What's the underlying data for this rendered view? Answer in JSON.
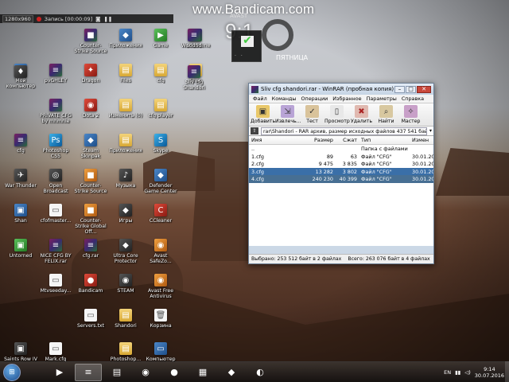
{
  "watermark": "www.Bandicam.com",
  "recorder": {
    "resolution": "1280x960",
    "status": "Запись [00:00:09]"
  },
  "gadget": {
    "brand": "AVAST",
    "time": "9:1",
    "day": "ПЯТНИЦА",
    "extra": "· ·"
  },
  "desktop_icons": [
    {
      "label": "1280x960",
      "glyph": "▣",
      "kind": "g-dark"
    },
    {
      "label": "Запись",
      "glyph": "●",
      "kind": "g-red"
    },
    {
      "label": "",
      "glyph": "≡",
      "kind": "g-rar"
    },
    {
      "label": "",
      "glyph": "▤",
      "kind": "g-folder"
    },
    {
      "label": "Сборник",
      "glyph": "▦",
      "kind": "g-folder"
    },
    {
      "label": "Лаунчер",
      "glyph": "■",
      "kind": "g-rar"
    },
    {
      "label": "Counter-Strike Source",
      "glyph": "■",
      "kind": "g-rar"
    },
    {
      "label": "Приложения",
      "glyph": "◆",
      "kind": "g-app"
    },
    {
      "label": "Game",
      "glyph": "▶",
      "kind": "g-green"
    },
    {
      "label": "WorldScene",
      "glyph": "≡",
      "kind": "g-rar"
    },
    {
      "label": "sound",
      "glyph": "≡",
      "kind": "g-rar"
    },
    {
      "label": "Мой компьютер",
      "glyph": "▭",
      "kind": "g-app"
    },
    {
      "label": "",
      "glyph": "♦",
      "kind": "g-dark"
    },
    {
      "label": "pvGHLEY",
      "glyph": "≡",
      "kind": "g-rar"
    },
    {
      "label": "Dragon",
      "glyph": "✦",
      "kind": "g-red"
    },
    {
      "label": "Files",
      "glyph": "▤",
      "kind": "g-folder"
    },
    {
      "label": "cfg",
      "glyph": "▤",
      "kind": "g-folder"
    },
    {
      "label": "Shop",
      "glyph": "▤",
      "kind": "g-folder"
    },
    {
      "label": "Sliv cfg Shandori",
      "glyph": "≡",
      "kind": "g-rar"
    },
    {
      "label": "PRIVATE CFG by mhmnie",
      "glyph": "≡",
      "kind": "g-rar"
    },
    {
      "label": "Dota 2",
      "glyph": "◉",
      "kind": "g-red"
    },
    {
      "label": "Изменить (0)",
      "glyph": "▤",
      "kind": "g-folder"
    },
    {
      "label": "cfg player",
      "glyph": "▤",
      "kind": "g-folder"
    },
    {
      "label": "cfg",
      "glyph": "≡",
      "kind": "g-rar"
    },
    {
      "label": "Photoshop CS5",
      "glyph": "Ps",
      "kind": "g-blue"
    },
    {
      "label": "Steam Skinpak",
      "glyph": "◆",
      "kind": "g-app"
    },
    {
      "label": "Приложения",
      "glyph": "▤",
      "kind": "g-folder"
    },
    {
      "label": "Skype",
      "glyph": "S",
      "kind": "g-blue"
    },
    {
      "label": "War Thunder",
      "glyph": "✈",
      "kind": "g-dark"
    },
    {
      "label": "Open Broadcast",
      "glyph": "◎",
      "kind": "g-dark"
    },
    {
      "label": "Counter-Strike Source",
      "glyph": "■",
      "kind": "g-orange"
    },
    {
      "label": "Музыка",
      "glyph": "♪",
      "kind": "g-dark"
    },
    {
      "label": "Defender Game Center",
      "glyph": "◆",
      "kind": "g-app"
    },
    {
      "label": "Shan",
      "glyph": "▣",
      "kind": "g-app"
    },
    {
      "label": "cfofmaster...",
      "glyph": "▭",
      "kind": "g-file"
    },
    {
      "label": "Counter-Strike Global Off...",
      "glyph": "■",
      "kind": "g-orange"
    },
    {
      "label": "Игры",
      "glyph": "◆",
      "kind": "g-dark"
    },
    {
      "label": "CCleaner",
      "glyph": "C",
      "kind": "g-red"
    },
    {
      "label": "Untorned",
      "glyph": "▣",
      "kind": "g-green"
    },
    {
      "label": "NICE CFG BY FELIX.rar",
      "glyph": "≡",
      "kind": "g-rar"
    },
    {
      "label": "cfg.rar",
      "glyph": "≡",
      "kind": "g-rar"
    },
    {
      "label": "Ultra Core Protector",
      "glyph": "◆",
      "kind": "g-dark"
    },
    {
      "label": "Avast SafeZo...",
      "glyph": "◉",
      "kind": "g-orange"
    },
    {
      "label": "Mtvseeday...",
      "glyph": "▭",
      "kind": "g-file"
    },
    {
      "label": "Bandicam",
      "glyph": "●",
      "kind": "g-red"
    },
    {
      "label": "STEAM",
      "glyph": "◉",
      "kind": "g-dark"
    },
    {
      "label": "Avast Free Antivirus",
      "glyph": "◉",
      "kind": "g-orange"
    },
    {
      "label": "Servers.txt",
      "glyph": "▭",
      "kind": "g-file"
    },
    {
      "label": "Shandori",
      "glyph": "▤",
      "kind": "g-folder"
    },
    {
      "label": "Корзина",
      "glyph": "🗑",
      "kind": "g-file"
    },
    {
      "label": "Saints Row IV",
      "glyph": "▣",
      "kind": "g-dark"
    },
    {
      "label": "Mark.cfg",
      "glyph": "▭",
      "kind": "g-file"
    },
    {
      "label": "Photoshop...",
      "glyph": "▤",
      "kind": "g-folder"
    },
    {
      "label": "Компьютер",
      "glyph": "▭",
      "kind": "g-app"
    }
  ],
  "winrar": {
    "title": "Sliv cfg shandori.rar - WinRAR (пробная копия)",
    "menu": [
      "Файл",
      "Команды",
      "Операции",
      "Избранное",
      "Параметры",
      "Справка"
    ],
    "toolbar": [
      {
        "label": "Добавить",
        "glyph": "▣"
      },
      {
        "label": "Извлечь...",
        "glyph": "⇲"
      },
      {
        "label": "Тест",
        "glyph": "✓"
      },
      {
        "label": "Просмотр",
        "glyph": "▯"
      },
      {
        "label": "Удалить",
        "glyph": "✖"
      },
      {
        "label": "Найти",
        "glyph": "⌕"
      },
      {
        "label": "Мастер",
        "glyph": "✧"
      }
    ],
    "path": "rar\\Shandori - RAR архив, размер исходных файлов 437 541 байт",
    "columns": {
      "name": "Имя",
      "size": "Размер",
      "comp": "Сжат",
      "type": "Тип",
      "date": "Измен"
    },
    "rows": [
      {
        "name": "..",
        "size": "",
        "comp": "",
        "type": "Папка с файлами",
        "date": ""
      },
      {
        "name": "1.cfg",
        "size": "89",
        "comp": "63",
        "type": "Файл \"CFG\"",
        "date": "30.01.20"
      },
      {
        "name": "2.cfg",
        "size": "9 475",
        "comp": "3 835",
        "type": "Файл \"CFG\"",
        "date": "30.01.20"
      },
      {
        "name": "3.cfg",
        "size": "13 282",
        "comp": "3 802",
        "type": "Файл \"CFG\"",
        "date": "30.01.20"
      },
      {
        "name": "4.cfg",
        "size": "240 230",
        "comp": "40 399",
        "type": "Файл \"CFG\"",
        "date": "30.01.20"
      }
    ],
    "status_left": "Выбрано: 253 512 байт в 2 файлах",
    "status_right": "Всего: 263 076 байт в 4 файлах"
  },
  "taskbar": {
    "items": [
      {
        "name": "task-media",
        "glyph": "▶"
      },
      {
        "name": "task-winrar",
        "glyph": "≡"
      },
      {
        "name": "task-files",
        "glyph": "▤"
      },
      {
        "name": "task-opera",
        "glyph": "◉"
      },
      {
        "name": "task-record",
        "glyph": "●"
      },
      {
        "name": "task-calc",
        "glyph": "▦"
      },
      {
        "name": "task-steam",
        "glyph": "◆"
      },
      {
        "name": "task-chrome",
        "glyph": "◐"
      }
    ],
    "lang": "EN",
    "time": "9:14",
    "date": "30.07.2016"
  }
}
